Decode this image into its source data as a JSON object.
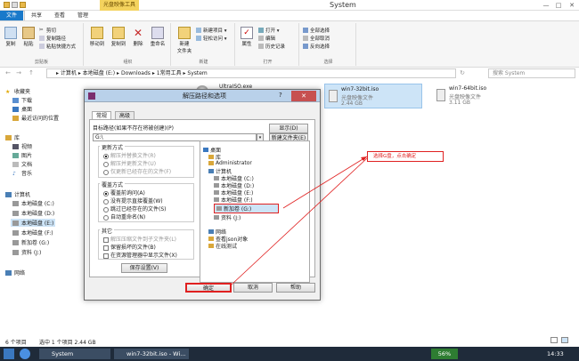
{
  "window": {
    "title": "System",
    "context_tab": "光盘映像工具"
  },
  "ribbon_tabs": [
    "文件",
    "主页",
    "共享",
    "查看",
    "管理"
  ],
  "ribbon": {
    "clipboard": {
      "copy": "复制",
      "paste": "粘贴",
      "cut": "剪切",
      "copy_path": "复制路径",
      "paste_shortcut": "粘贴快捷方式",
      "label": "剪贴板"
    },
    "organize": {
      "move_to": "移动到",
      "copy_to": "复制到",
      "delete": "删除",
      "rename": "重命名",
      "label": "组织"
    },
    "new": {
      "new_folder": "新建\n文件夹",
      "new_item": "新建项目 ▾",
      "easy_access": "轻松访问 ▾",
      "label": "新建"
    },
    "open": {
      "properties": "属性",
      "open": "打开 ▾",
      "edit": "编辑",
      "history": "历史记录",
      "label": "打开"
    },
    "select": {
      "select_all": "全部选择",
      "select_none": "全部取消",
      "invert": "反向选择",
      "label": "选择"
    }
  },
  "address": {
    "path": "▸ 计算机 ▸ 本地磁盘 (E:) ▸ Downloads ▸ 1常用工具 ▸ System",
    "search_placeholder": "搜索 System"
  },
  "nav": {
    "favorites": "收藏夹",
    "downloads": "下载",
    "desktop": "桌面",
    "recent": "最近访问的位置",
    "library": "库",
    "videos": "视频",
    "pictures": "图片",
    "documents": "文档",
    "music": "音乐",
    "computer": "计算机",
    "c": "本地磁盘 (C:)",
    "d": "本地磁盘 (D:)",
    "e": "本地磁盘 (E:)",
    "f": "本地磁盘 (F:)",
    "g": "新加卷 (G:)",
    "j": "资料 (J:)",
    "network": "网络"
  },
  "files": [
    {
      "name": "UltraISO.exe",
      "sub": ""
    },
    {
      "name": "win7-32bit.iso",
      "sub": "光盘映像文件",
      "size": "2.44 GB"
    },
    {
      "name": "win7-64bit.iso",
      "sub": "光盘映像文件",
      "size": "3.11 GB"
    }
  ],
  "dialog": {
    "title": "解压路径和选项",
    "help": "?",
    "close": "✕",
    "tabs": [
      "常规",
      "高级"
    ],
    "target_label": "目标路径(如果不存在将被创建)(P)",
    "target_value": "G:\\",
    "show_button": "显示(D)",
    "new_folder_button": "新建文件夹(E)",
    "update_mode": {
      "title": "更新方式",
      "opts": [
        "解压并替换文件(R)",
        "解压并更新文件(U)",
        "仅更新已经存在的文件(F)"
      ]
    },
    "overwrite_mode": {
      "title": "覆盖方式",
      "opts": [
        "覆盖前询问(A)",
        "没有提示直接覆盖(W)",
        "跳过已经存在的文件(S)",
        "自动重命名(N)"
      ]
    },
    "other": {
      "title": "其它",
      "opts": [
        "解压压缩文件到子文件夹(L)",
        "保留损坏的文件(B)",
        "在资源管理器中显示文件(X)"
      ]
    },
    "save_button": "保存设置(V)",
    "tree": [
      "桌面",
      "库",
      "Administrator",
      "计算机",
      "本地磁盘 (C:)",
      "本地磁盘 (D:)",
      "本地磁盘 (E:)",
      "本地磁盘 (F:)",
      "新加卷 (G:)",
      "资料 (J:)",
      "网络",
      "查看json对象",
      "在线测试"
    ],
    "ok": "确定",
    "cancel": "取消",
    "help_button": "帮助"
  },
  "annotation": "选择G盘，点击确定",
  "status": {
    "count": "6 个项目",
    "selected": "选中 1 个项目  2.44 GB"
  },
  "taskbar": {
    "explorer": "System",
    "winrar": "win7-32bit.iso - Wi...",
    "battery": "56%",
    "time": "14:33"
  },
  "colors": {
    "accent": "#1979ca",
    "annotation": "#e02020",
    "context_tab": "#f4d35e",
    "close": "#c75050"
  }
}
